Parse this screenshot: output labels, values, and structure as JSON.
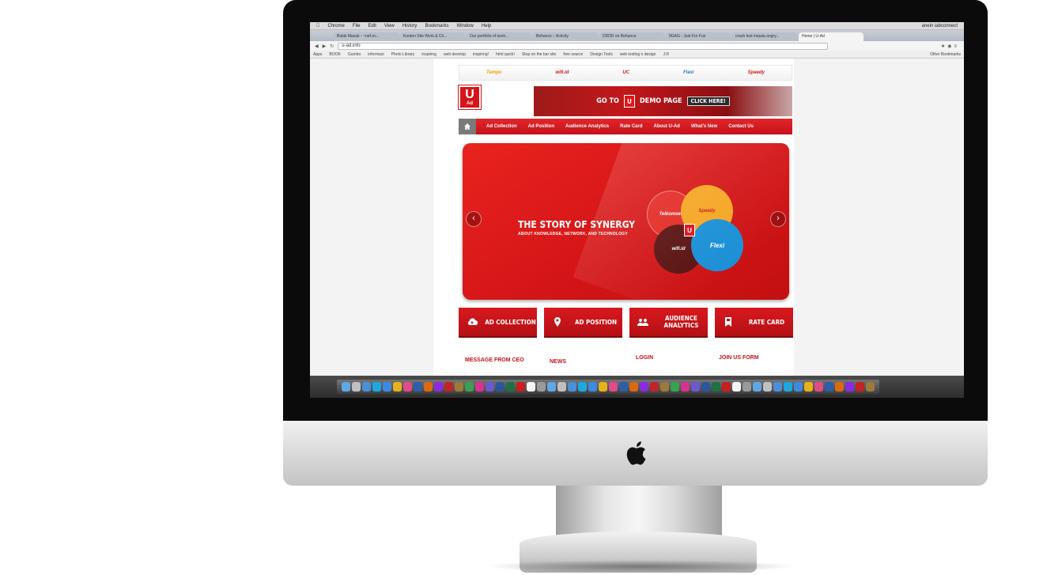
{
  "menubar": {
    "items": [
      "Chrome",
      "File",
      "Edit",
      "View",
      "History",
      "Bookmarks",
      "Window",
      "Help"
    ],
    "right": "anein iabconnect"
  },
  "tabs": [
    {
      "label": "Bulak Masuk - ~nef.nc...",
      "active": false
    },
    {
      "label": "Konten Site Work & Ch...",
      "active": false
    },
    {
      "label": "Our portfolio of work...",
      "active": false
    },
    {
      "label": "Behance :: Activity",
      "active": false
    },
    {
      "label": "DDDD on Behance",
      "active": false
    },
    {
      "label": "9GAG - Just For Fun",
      "active": false
    },
    {
      "label": "crash test impala angry...",
      "active": false
    },
    {
      "label": "Home | U-Ad",
      "active": true
    }
  ],
  "address": {
    "url": "u-ad.info"
  },
  "bookmarks": {
    "items": [
      "Apps",
      "BOOK",
      "Gumbo",
      "informasi",
      "Photo Library",
      "inspiring",
      "web develop",
      "inspiring!",
      "html quick!",
      "Stop on the bar site",
      "free source",
      "Design Tools",
      "web testing n design",
      "J.R"
    ],
    "other": "Other Bookmarks"
  },
  "partners": [
    "Tempo",
    "wifi.id",
    "UC",
    "Flexi",
    "Speedy"
  ],
  "logo": {
    "u": "U",
    "ad": "Ad"
  },
  "demo_banner": {
    "go_to": "GO TO",
    "u": "U",
    "demo_page": "DEMO PAGE",
    "click": "CLICK HERE!"
  },
  "nav": {
    "items": [
      "Ad Collection",
      "Ad Position",
      "Audience Analytics",
      "Rate Card",
      "About U-Ad",
      "What's New",
      "Contact Us"
    ]
  },
  "hero": {
    "title": "THE STORY OF SYNERGY",
    "subtitle": "ABOUT KNOWLEDGE, NETWORK, AND TECHNOLOGY",
    "circles": [
      "Telkomsel",
      "Speedy",
      "U",
      "Flexi",
      "wifi.id"
    ]
  },
  "quick_buttons": [
    {
      "label": "AD COLLECTION",
      "icon": "cloud-upload-icon"
    },
    {
      "label": "AD POSITION",
      "icon": "map-pin-icon"
    },
    {
      "label": "AUDIENCE ANALYTICS",
      "icon": "users-icon"
    },
    {
      "label": "RATE CARD",
      "icon": "bookmark-icon"
    }
  ],
  "footer_links": [
    "MESSAGE FROM CEO",
    "NEWS",
    "LOGIN",
    "JOIN US FORM"
  ],
  "colors": {
    "brand_red": "#d4161b",
    "nav_home": "#7a7a7a",
    "dock": "#3a3a3a"
  },
  "dock_icons": [
    "finder-icon",
    "launchpad-icon",
    "mail-icon",
    "skype-icon",
    "safari-icon",
    "chrome-icon",
    "itunes-icon",
    "photoshop-icon",
    "illustrator-icon",
    "premiere-icon",
    "fireworks-icon",
    "bridge-icon",
    "dreamweaver-icon",
    "indesign-icon",
    "aftereffects-icon",
    "word-icon",
    "excel-icon",
    "filezilla-icon",
    "preview-icon",
    "trash-icon"
  ]
}
